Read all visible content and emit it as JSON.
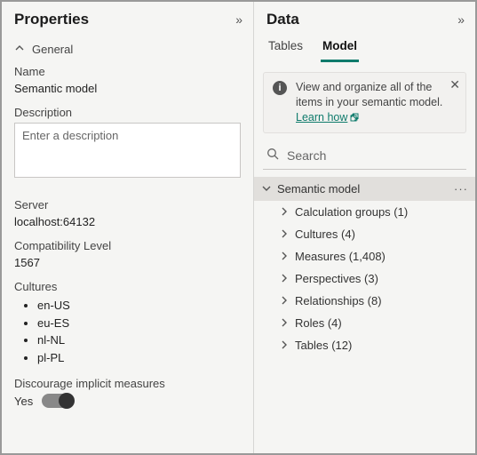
{
  "properties": {
    "title": "Properties",
    "section_general": "General",
    "name_label": "Name",
    "name_value": "Semantic model",
    "description_label": "Description",
    "description_placeholder": "Enter a description",
    "server_label": "Server",
    "server_value": "localhost:64132",
    "compat_label": "Compatibility Level",
    "compat_value": "1567",
    "cultures_label": "Cultures",
    "cultures": [
      "en-US",
      "eu-ES",
      "nl-NL",
      "pl-PL"
    ],
    "discourage_label": "Discourage implicit measures",
    "discourage_value": "Yes"
  },
  "data_panel": {
    "title": "Data",
    "tabs": {
      "tables": "Tables",
      "model": "Model"
    },
    "info": {
      "text": "View and organize all of the items in your semantic model.",
      "link": "Learn how"
    },
    "search_placeholder": "Search",
    "root": "Semantic model",
    "items": [
      {
        "label": "Calculation groups",
        "count": 1
      },
      {
        "label": "Cultures",
        "count": 4
      },
      {
        "label": "Measures",
        "count": 1408
      },
      {
        "label": "Perspectives",
        "count": 3
      },
      {
        "label": "Relationships",
        "count": 8
      },
      {
        "label": "Roles",
        "count": 4
      },
      {
        "label": "Tables",
        "count": 12
      }
    ]
  }
}
